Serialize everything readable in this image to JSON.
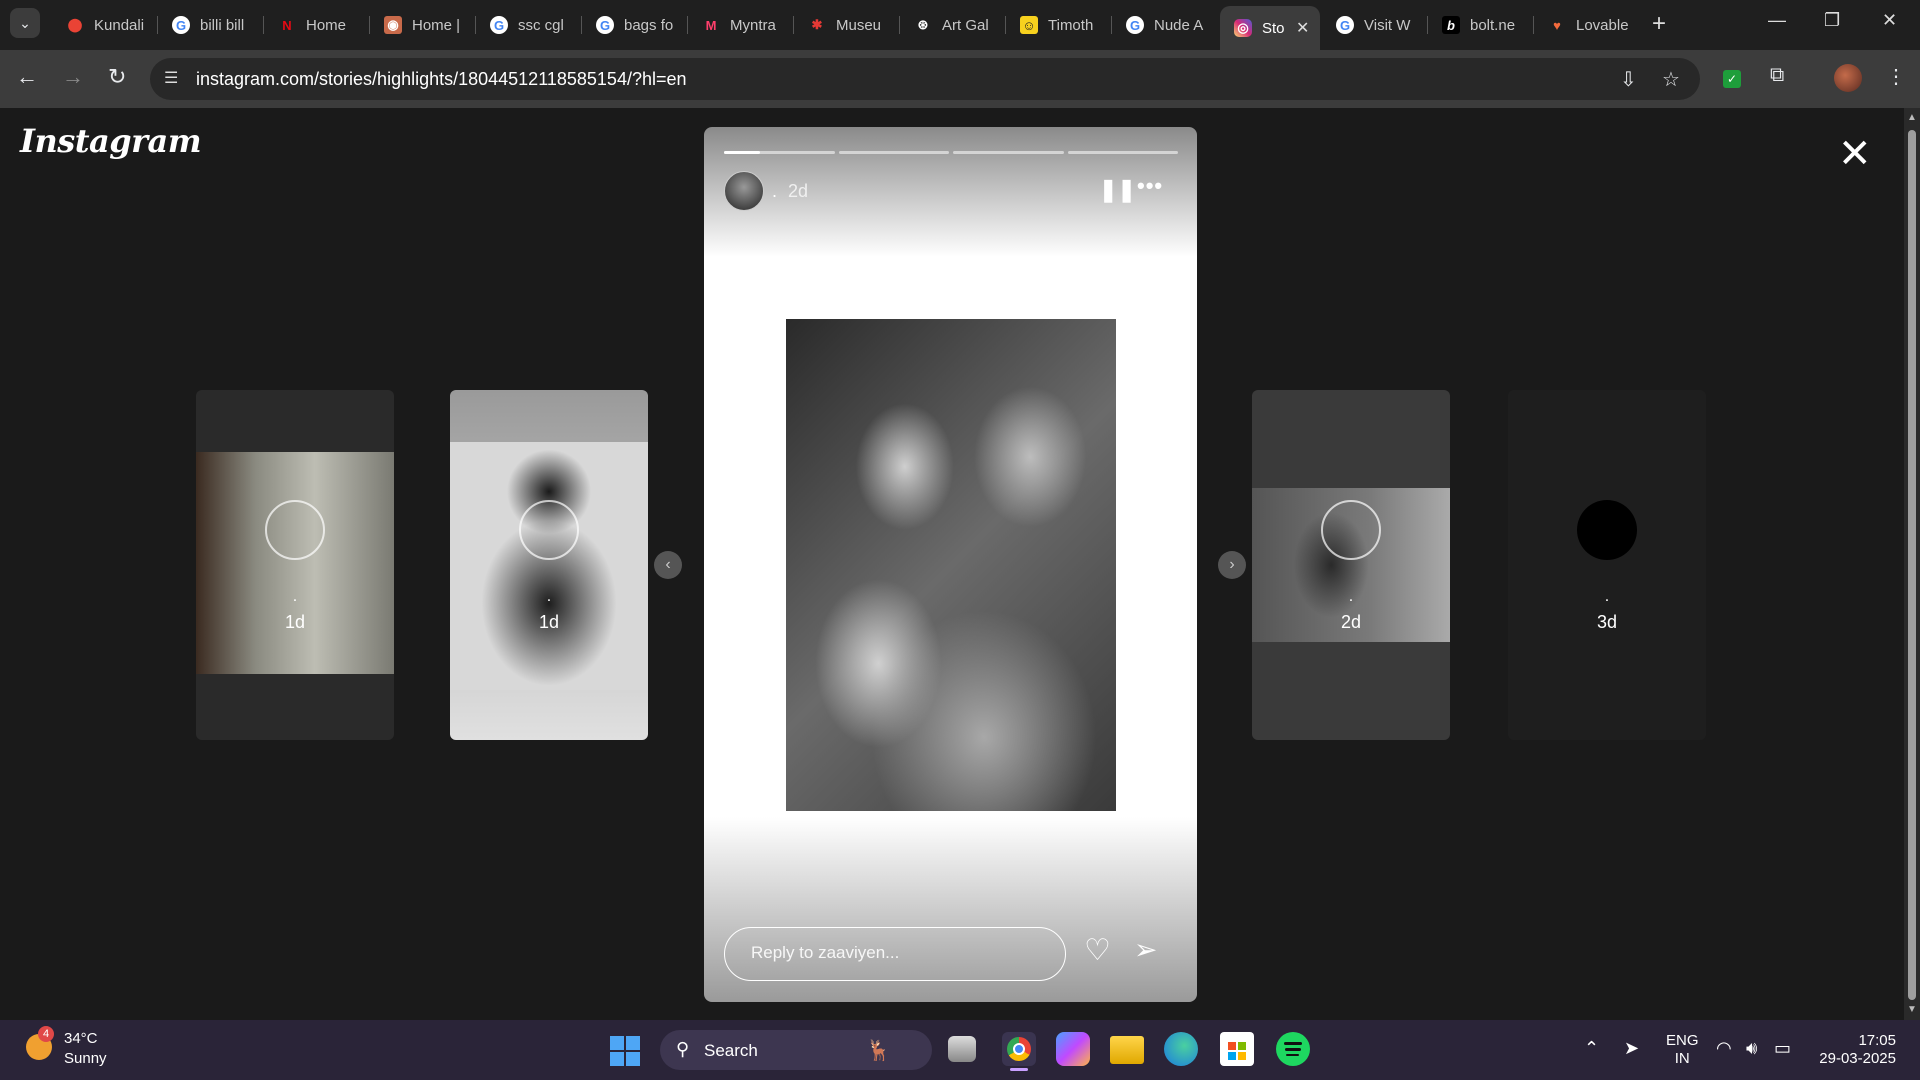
{
  "browser": {
    "tabs": [
      {
        "label": "Kundali",
        "icon": "maps-icon",
        "color": "#ea4335"
      },
      {
        "label": "billi bill",
        "icon": "google-icon",
        "color": "#4285f4"
      },
      {
        "label": "Home",
        "icon": "netflix-icon",
        "color": "#e50914"
      },
      {
        "label": "Home |",
        "icon": "site-icon",
        "color": "#c86a4a"
      },
      {
        "label": "ssc cgl",
        "icon": "google-icon",
        "color": "#4285f4"
      },
      {
        "label": "bags fo",
        "icon": "google-icon",
        "color": "#4285f4"
      },
      {
        "label": "Myntra",
        "icon": "myntra-icon",
        "color": "#ff3f6c"
      },
      {
        "label": "Museu",
        "icon": "asterisk-icon",
        "color": "#e53935"
      },
      {
        "label": "Art Gal",
        "icon": "openai-icon",
        "color": "#ffffff"
      },
      {
        "label": "Timoth",
        "icon": "site-icon",
        "color": "#f7d11e"
      },
      {
        "label": "Nude A",
        "icon": "google-icon",
        "color": "#4285f4"
      },
      {
        "label": "Sto",
        "icon": "instagram-icon",
        "color": "#d62976",
        "active": true
      },
      {
        "label": "Visit W",
        "icon": "google-icon",
        "color": "#4285f4"
      },
      {
        "label": "bolt.ne",
        "icon": "bolt-icon",
        "color": "#ffffff"
      },
      {
        "label": "Lovable",
        "icon": "heart-icon",
        "color": "#f36a3c"
      }
    ],
    "url": "instagram.com/stories/highlights/18044512118585154/?hl=en"
  },
  "page": {
    "logo": "Instagram",
    "story": {
      "username": ".",
      "time": "2d",
      "progress": 0.33,
      "reply_placeholder": "Reply to zaaviyen..."
    },
    "previews": [
      {
        "user": ".",
        "time": "1d"
      },
      {
        "user": ".",
        "time": "1d"
      },
      {
        "user": ".",
        "time": "2d"
      },
      {
        "user": ".",
        "time": "3d"
      }
    ]
  },
  "taskbar": {
    "weather_badge": "4",
    "temperature": "34°C",
    "condition": "Sunny",
    "search_label": "Search",
    "lang_top": "ENG",
    "lang_bottom": "IN",
    "time": "17:05",
    "date": "29-03-2025"
  }
}
